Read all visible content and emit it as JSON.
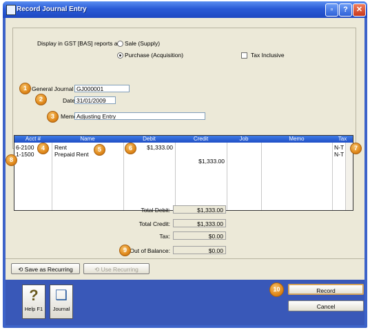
{
  "window": {
    "title": "Record Journal Entry"
  },
  "gst": {
    "label": "Display in GST [BAS] reports as:",
    "option_sale": "Sale (Supply)",
    "option_purchase": "Purchase (Acquisition)",
    "selected": "purchase",
    "tax_inclusive_label": "Tax Inclusive",
    "tax_inclusive_checked": false
  },
  "form": {
    "journal_label": "General Journal #:",
    "journal_value": "GJ000001",
    "date_label": "Date:",
    "date_value": "31/01/2009",
    "memo_label": "Memo:",
    "memo_value": "Adjusting Entry"
  },
  "grid": {
    "columns": [
      "Acct #",
      "Name",
      "Debit",
      "Credit",
      "Job",
      "Memo",
      "Tax"
    ],
    "rows": [
      {
        "acct": "6-2100",
        "name": "Rent",
        "debit": "$1,333.00",
        "credit": "",
        "job": "",
        "memo": "",
        "tax": "N-T"
      },
      {
        "acct": "1-1500",
        "name": "Prepaid Rent",
        "debit": "",
        "credit": "$1,333.00",
        "job": "",
        "memo": "",
        "tax": "N-T"
      }
    ]
  },
  "totals": {
    "debit_label": "Total Debit:",
    "debit_value": "$1,333.00",
    "credit_label": "Total Credit:",
    "credit_value": "$1,333.00",
    "tax_label": "Tax:",
    "tax_value": "$0.00",
    "balance_label": "Out of Balance:",
    "balance_value": "$0.00"
  },
  "buttons": {
    "save_recurring": "Save as Recurring",
    "use_recurring": "Use Recurring",
    "help": "Help F1",
    "journal": "Journal",
    "record": "Record",
    "cancel": "Cancel"
  },
  "callouts": [
    "1",
    "2",
    "3",
    "4",
    "5",
    "6",
    "7",
    "8",
    "9",
    "10"
  ],
  "colors": {
    "titlebar": "#2b5bd6",
    "grid_header": "#1f4fc6",
    "callout": "#e0891b"
  }
}
